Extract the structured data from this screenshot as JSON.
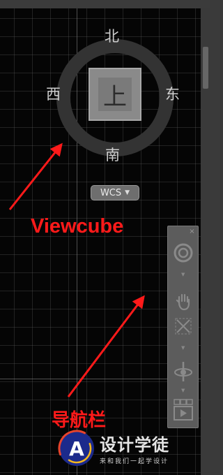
{
  "viewcube": {
    "face_label": "上",
    "north": "北",
    "south": "南",
    "west": "西",
    "east": "东",
    "coord_system": "WCS"
  },
  "annotations": {
    "viewcube_label": "Viewcube",
    "navbar_label": "导航栏",
    "annotation_color": "#ff1a1a"
  },
  "navbar": {
    "close_glyph": "×",
    "tools": [
      {
        "icon": "steering-wheel-icon"
      },
      {
        "icon": "pan-hand-icon"
      },
      {
        "icon": "zoom-extents-icon"
      },
      {
        "icon": "orbit-icon"
      },
      {
        "icon": "showmotion-icon"
      }
    ]
  },
  "watermark": {
    "logo_letter": "A",
    "title": "设计学徒",
    "subtitle": "来和我们一起学设计"
  },
  "colors": {
    "viewport_bg": "#050505",
    "panel_bg": "#3a3a3a",
    "navbar_bg": "#5c5c5c"
  }
}
